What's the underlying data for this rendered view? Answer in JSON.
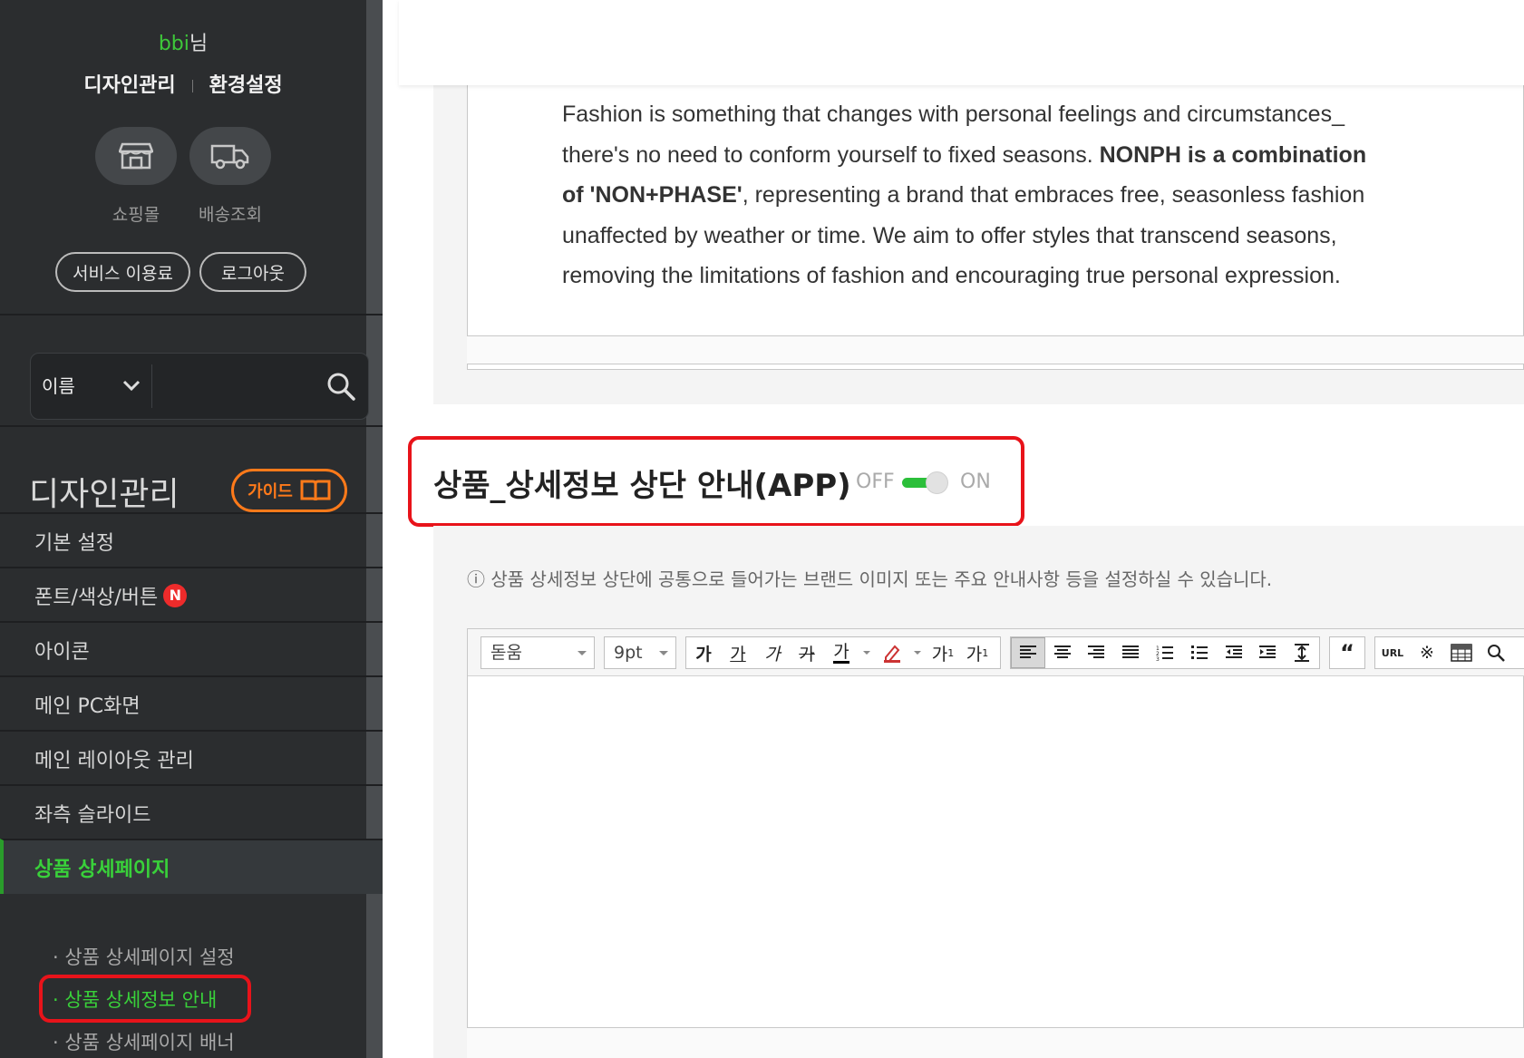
{
  "sidebar": {
    "user_name": "bbi",
    "user_suffix": "님",
    "link_design": "디자인관리",
    "link_settings": "환경설정",
    "quick_shop": "쇼핑몰",
    "quick_delivery": "배송조회",
    "service_fee": "서비스 이용료",
    "logout": "로그아웃",
    "search_select": "이름",
    "menu_title": "디자인관리",
    "guide": "가이드",
    "menu": [
      {
        "label": "기본 설정"
      },
      {
        "label": "폰트/색상/버튼",
        "badge": "N"
      },
      {
        "label": "아이콘"
      },
      {
        "label": "메인 PC화면"
      },
      {
        "label": "메인 레이아웃 관리"
      },
      {
        "label": "좌측 슬라이드"
      },
      {
        "label": "상품 상세페이지"
      }
    ],
    "submenu": [
      {
        "label": "· 상품 상세페이지 설정"
      },
      {
        "label": "· 상품 상세정보 안내"
      },
      {
        "label": "· 상품 상세페이지 배너"
      }
    ]
  },
  "main": {
    "para1": "Fashion is something that changes with personal feelings and circumstances_",
    "para2a": "there's no need to conform yourself to fixed seasons. ",
    "para2b": "NONPH is a combination",
    "para3a": "of 'NON+PHASE'",
    "para3b": ", representing a brand that embraces free, seasonless fashion",
    "para4": "unaffected by weather or time. We aim to offer styles that transcend seasons,",
    "para5": "removing the limitations of fashion and encouraging true personal expression.",
    "section_title": "상품_상세정보 상단 안내(APP)",
    "toggle_off": "OFF",
    "toggle_on": "ON",
    "toggle_state": "on",
    "info": "ⓘ 상품 상세정보 상단에 공통으로 들어가는 브랜드 이미지 또는 주요 안내사항 등을 설정하실 수 있습니다.",
    "toolbar": {
      "font": "돋움",
      "size": "9pt",
      "url": "URL"
    }
  },
  "colors": {
    "accent_green": "#39d13a",
    "highlight_red": "#e8131a",
    "guide_orange": "#ff7a1a"
  }
}
